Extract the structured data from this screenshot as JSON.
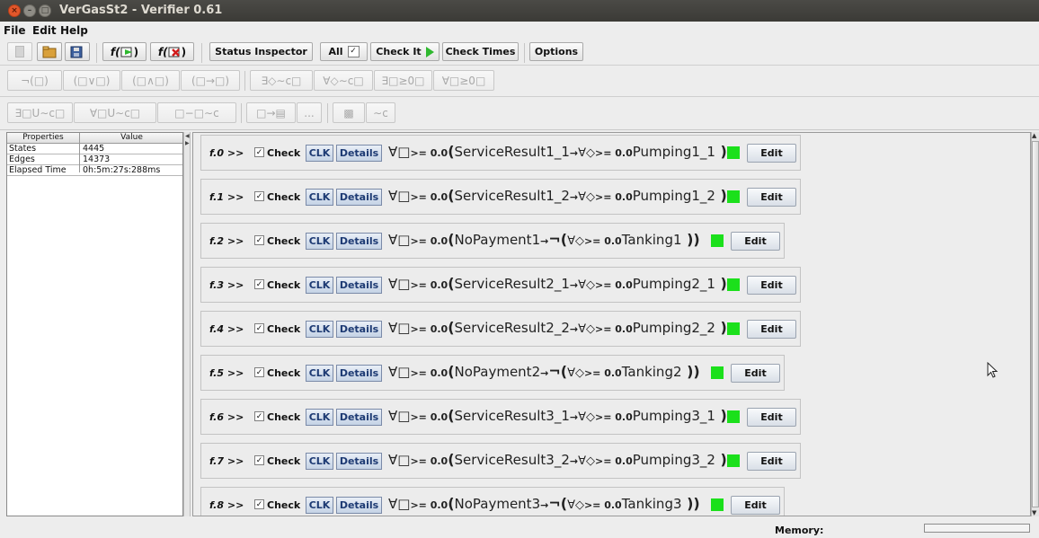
{
  "window": {
    "title": "VerGasSt2 - Verifier 0.61"
  },
  "menu": [
    "File",
    "Edit",
    "Help"
  ],
  "toolbar": {
    "status_inspector": "Status Inspector",
    "all_label": "All",
    "check_it": "Check It",
    "check_times": "Check Times",
    "options": "Options",
    "fx_add": "f(",
    "fx_remove": "f("
  },
  "operators_row1": [
    "¬(□)",
    "(□∨□)",
    "(□∧□)",
    "(□→□)",
    "∃◇∼c□",
    "∀◇∼c□",
    "∃□≥0□",
    "∀□≥0□"
  ],
  "operators_row2": [
    "∃□U∼c□",
    "∀□U∼c□",
    "□−□∼c",
    "□→▤",
    "...",
    "▩",
    "∼c"
  ],
  "properties": {
    "headers": [
      "Properties",
      "Value"
    ],
    "rows": [
      {
        "name": "States",
        "value": "4445"
      },
      {
        "name": "Edges",
        "value": "14373"
      },
      {
        "name": "Elapsed Time",
        "value": "0h:5m:27s:288ms"
      }
    ]
  },
  "formula_row": {
    "check_label": "Check",
    "clk_label": "CLK",
    "details_label": "Details",
    "edit_label": "Edit",
    "q1": "∀□",
    "q2": "∀◇",
    "sub": ">= 0.0",
    "arrow": "→",
    "neg": "¬"
  },
  "formulas": [
    {
      "id": "f.0 >>",
      "left": "ServiceResult1_1",
      "right": "Pumping1_1",
      "negated": false
    },
    {
      "id": "f.1 >>",
      "left": "ServiceResult1_2",
      "right": "Pumping1_2",
      "negated": false
    },
    {
      "id": "f.2 >>",
      "left": "NoPayment1",
      "right": "Tanking1",
      "negated": true
    },
    {
      "id": "f.3 >>",
      "left": "ServiceResult2_1",
      "right": "Pumping2_1",
      "negated": false
    },
    {
      "id": "f.4 >>",
      "left": "ServiceResult2_2",
      "right": "Pumping2_2",
      "negated": false
    },
    {
      "id": "f.5 >>",
      "left": "NoPayment2",
      "right": "Tanking2",
      "negated": true
    },
    {
      "id": "f.6 >>",
      "left": "ServiceResult3_1",
      "right": "Pumping3_1",
      "negated": false
    },
    {
      "id": "f.7 >>",
      "left": "ServiceResult3_2",
      "right": "Pumping3_2",
      "negated": false
    },
    {
      "id": "f.8 >>",
      "left": "NoPayment3",
      "right": "Tanking3",
      "negated": true
    }
  ],
  "status_bar": {
    "memory_label": "Memory:"
  },
  "colors": {
    "status_ok": "#1be01b",
    "accent": "#1d3a73"
  }
}
